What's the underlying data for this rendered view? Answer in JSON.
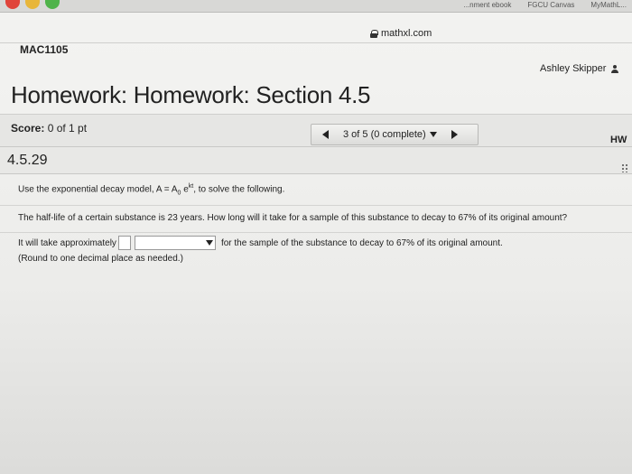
{
  "browser": {
    "tabs": [
      "...nment ebook",
      "FGCU Canvas",
      "MyMathL..."
    ],
    "url": "mathxl.com"
  },
  "course": {
    "code": "MAC1105"
  },
  "user": {
    "name": "Ashley Skipper"
  },
  "header": {
    "title": "Homework: Homework: Section 4.5"
  },
  "score": {
    "label": "Score:",
    "value": "0 of 1 pt"
  },
  "nav": {
    "progress": "3 of 5 (0 complete)"
  },
  "hw_label": "HW",
  "question": {
    "number": "4.5.29",
    "intro_prefix": "Use the exponential decay model, A",
    "eq_mid": " = A",
    "sub_0": "0",
    "eq_e": " e",
    "sup_kt": "kt",
    "intro_suffix": ", to solve the following.",
    "prompt": "The half-life of a certain substance is 23 years. How long will it take for a sample of this substance to decay to 67% of its original amount?",
    "answer_prefix": "It will take approximately",
    "answer_suffix": "for the sample of the substance to decay to 67% of its original amount.",
    "hint": "(Round to one decimal place as needed.)",
    "answer_value": "",
    "unit_value": ""
  },
  "colors": {
    "chrome_red": "#e0443a",
    "chrome_yellow": "#e8b63a",
    "chrome_green": "#4fb34a"
  }
}
